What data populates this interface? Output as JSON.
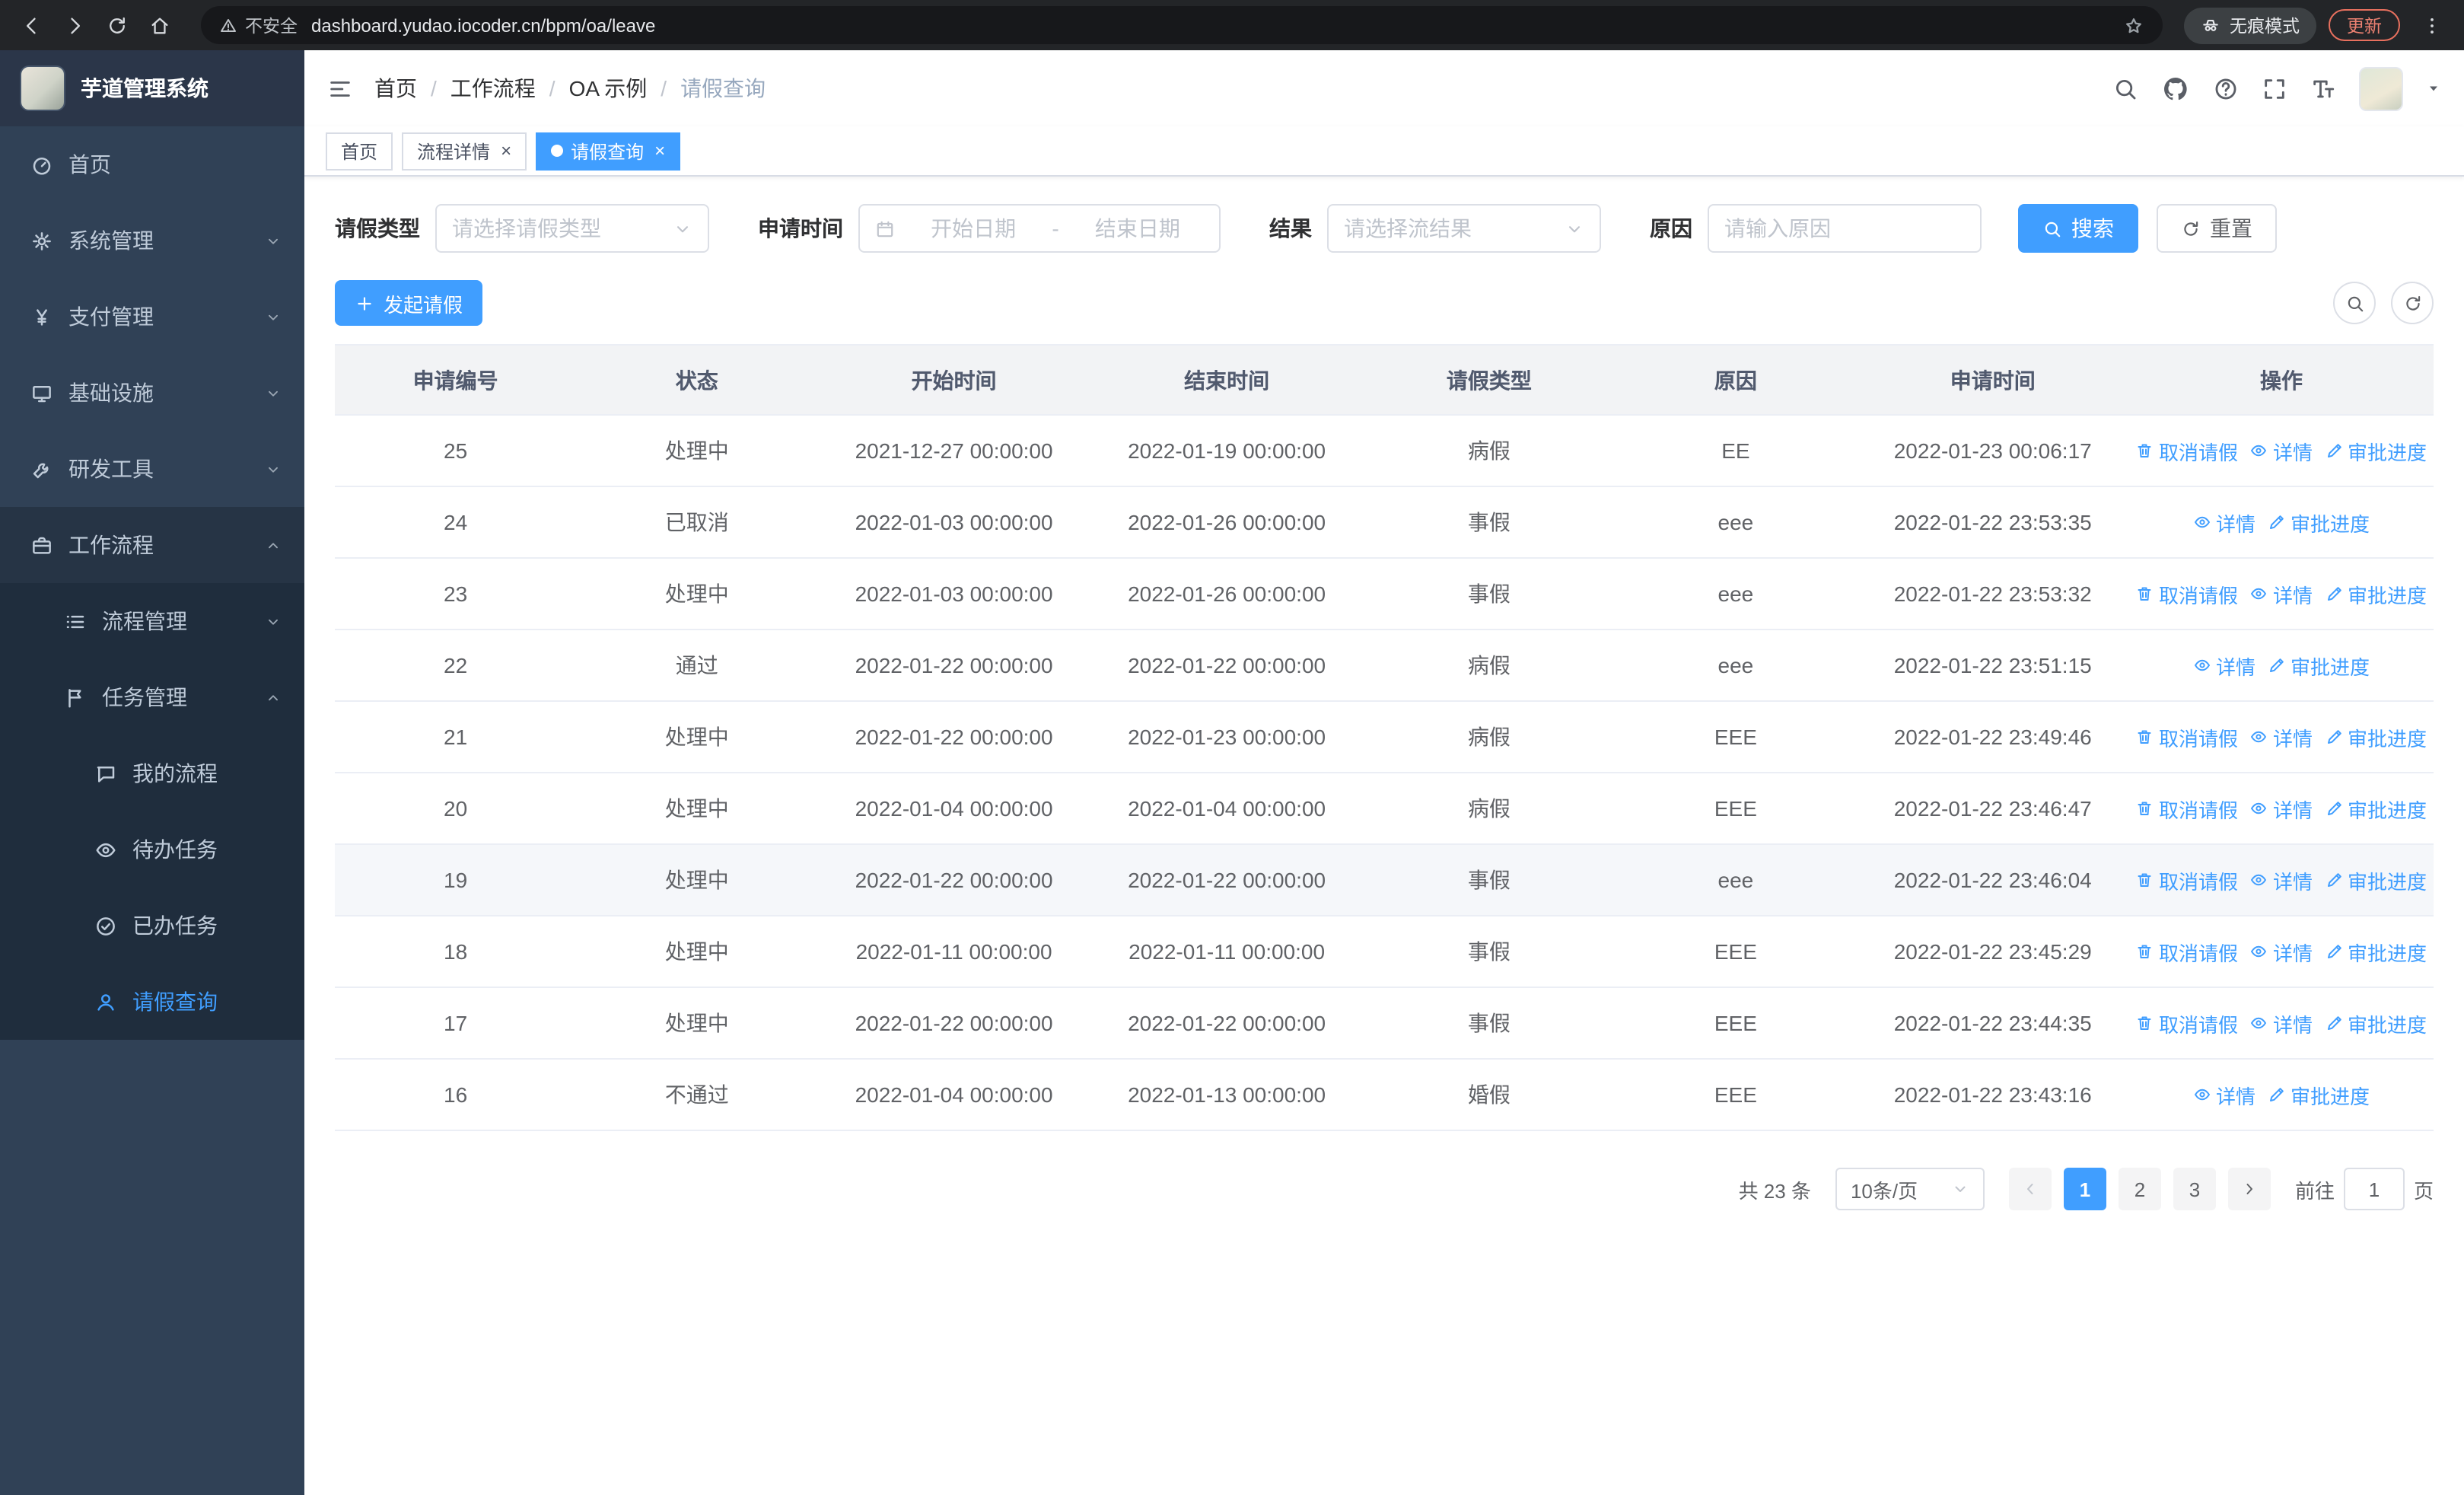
{
  "browser": {
    "security_label": "不安全",
    "url": "dashboard.yudao.iocoder.cn/bpm/oa/leave",
    "incognito_label": "无痕模式",
    "update_label": "更新"
  },
  "sidebar": {
    "title": "芋道管理系统",
    "items": [
      {
        "name": "home",
        "label": "首页",
        "icon": "dashboard",
        "level": 1
      },
      {
        "name": "system",
        "label": "系统管理",
        "icon": "gear",
        "level": 1,
        "chevron": "down"
      },
      {
        "name": "payment",
        "label": "支付管理",
        "icon": "yen",
        "level": 1,
        "chevron": "down"
      },
      {
        "name": "infrastructure",
        "label": "基础设施",
        "icon": "monitor",
        "level": 1,
        "chevron": "down"
      },
      {
        "name": "devtools",
        "label": "研发工具",
        "icon": "tools",
        "level": 1,
        "chevron": "down"
      },
      {
        "name": "workflow",
        "label": "工作流程",
        "icon": "briefcase",
        "level": 1,
        "chevron": "up",
        "open": true
      },
      {
        "name": "process-mgmt",
        "label": "流程管理",
        "icon": "list",
        "level": 2,
        "sub": true,
        "chevron": "down"
      },
      {
        "name": "task-mgmt",
        "label": "任务管理",
        "icon": "flag",
        "level": 2,
        "sub": true,
        "chevron": "up"
      },
      {
        "name": "my-process",
        "label": "我的流程",
        "icon": "chat",
        "level": 3,
        "sub": true
      },
      {
        "name": "todo-tasks",
        "label": "待办任务",
        "icon": "eye",
        "level": 3,
        "sub": true
      },
      {
        "name": "done-tasks",
        "label": "已办任务",
        "icon": "done",
        "level": 3,
        "sub": true
      },
      {
        "name": "leave-query",
        "label": "请假查询",
        "icon": "user",
        "level": 3,
        "sub": true,
        "active": true
      }
    ]
  },
  "header": {
    "breadcrumb": [
      {
        "name": "home",
        "label": "首页"
      },
      {
        "name": "workflow",
        "label": "工作流程"
      },
      {
        "name": "oa-example",
        "label": "OA 示例"
      },
      {
        "name": "leave-query",
        "label": "请假查询"
      }
    ]
  },
  "tabs": [
    {
      "name": "home",
      "label": "首页",
      "closable": false,
      "active": false
    },
    {
      "name": "process-detail",
      "label": "流程详情",
      "closable": true,
      "active": false
    },
    {
      "name": "leave-query",
      "label": "请假查询",
      "closable": true,
      "active": true
    }
  ],
  "filters": {
    "leave_type": {
      "label": "请假类型",
      "placeholder": "请选择请假类型"
    },
    "apply_time": {
      "label": "申请时间",
      "start_placeholder": "开始日期",
      "separator": "-",
      "end_placeholder": "结束日期"
    },
    "result": {
      "label": "结果",
      "placeholder": "请选择流结果"
    },
    "reason": {
      "label": "原因",
      "placeholder": "请输入原因"
    },
    "search_label": "搜索",
    "reset_label": "重置"
  },
  "toolbar": {
    "create_label": "发起请假"
  },
  "table": {
    "columns": [
      "申请编号",
      "状态",
      "开始时间",
      "结束时间",
      "请假类型",
      "原因",
      "申请时间",
      "操作"
    ],
    "action_defs": {
      "cancel": {
        "label": "取消请假",
        "icon": "trash"
      },
      "detail": {
        "label": "详情",
        "icon": "eye"
      },
      "progress": {
        "label": "审批进度",
        "icon": "edit"
      }
    },
    "rows": [
      {
        "id": "25",
        "status": "处理中",
        "start": "2021-12-27 00:00:00",
        "end": "2022-01-19 00:00:00",
        "type": "病假",
        "reason": "EE",
        "apply_time": "2022-01-23 00:06:17",
        "actions": [
          "cancel",
          "detail",
          "progress"
        ]
      },
      {
        "id": "24",
        "status": "已取消",
        "start": "2022-01-03 00:00:00",
        "end": "2022-01-26 00:00:00",
        "type": "事假",
        "reason": "eee",
        "apply_time": "2022-01-22 23:53:35",
        "actions": [
          "detail",
          "progress"
        ]
      },
      {
        "id": "23",
        "status": "处理中",
        "start": "2022-01-03 00:00:00",
        "end": "2022-01-26 00:00:00",
        "type": "事假",
        "reason": "eee",
        "apply_time": "2022-01-22 23:53:32",
        "actions": [
          "cancel",
          "detail",
          "progress"
        ]
      },
      {
        "id": "22",
        "status": "通过",
        "start": "2022-01-22 00:00:00",
        "end": "2022-01-22 00:00:00",
        "type": "病假",
        "reason": "eee",
        "apply_time": "2022-01-22 23:51:15",
        "actions": [
          "detail",
          "progress"
        ]
      },
      {
        "id": "21",
        "status": "处理中",
        "start": "2022-01-22 00:00:00",
        "end": "2022-01-23 00:00:00",
        "type": "病假",
        "reason": "EEE",
        "apply_time": "2022-01-22 23:49:46",
        "actions": [
          "cancel",
          "detail",
          "progress"
        ]
      },
      {
        "id": "20",
        "status": "处理中",
        "start": "2022-01-04 00:00:00",
        "end": "2022-01-04 00:00:00",
        "type": "病假",
        "reason": "EEE",
        "apply_time": "2022-01-22 23:46:47",
        "actions": [
          "cancel",
          "detail",
          "progress"
        ]
      },
      {
        "id": "19",
        "status": "处理中",
        "start": "2022-01-22 00:00:00",
        "end": "2022-01-22 00:00:00",
        "type": "事假",
        "reason": "eee",
        "apply_time": "2022-01-22 23:46:04",
        "actions": [
          "cancel",
          "detail",
          "progress"
        ],
        "highlight": true
      },
      {
        "id": "18",
        "status": "处理中",
        "start": "2022-01-11 00:00:00",
        "end": "2022-01-11 00:00:00",
        "type": "事假",
        "reason": "EEE",
        "apply_time": "2022-01-22 23:45:29",
        "actions": [
          "cancel",
          "detail",
          "progress"
        ]
      },
      {
        "id": "17",
        "status": "处理中",
        "start": "2022-01-22 00:00:00",
        "end": "2022-01-22 00:00:00",
        "type": "事假",
        "reason": "EEE",
        "apply_time": "2022-01-22 23:44:35",
        "actions": [
          "cancel",
          "detail",
          "progress"
        ]
      },
      {
        "id": "16",
        "status": "不通过",
        "start": "2022-01-04 00:00:00",
        "end": "2022-01-13 00:00:00",
        "type": "婚假",
        "reason": "EEE",
        "apply_time": "2022-01-22 23:43:16",
        "actions": [
          "detail",
          "progress"
        ]
      }
    ]
  },
  "pagination": {
    "total_label": "共 23 条",
    "page_size_label": "10条/页",
    "pages": [
      "1",
      "2",
      "3"
    ],
    "active_page": "1",
    "goto_prefix": "前往",
    "goto_value": "1",
    "goto_suffix": "页"
  },
  "colors": {
    "primary": "#409eff",
    "sidebar_bg": "#304156",
    "sidebar_sub_bg": "#1f2d3d",
    "update_accent": "#ee8272"
  }
}
